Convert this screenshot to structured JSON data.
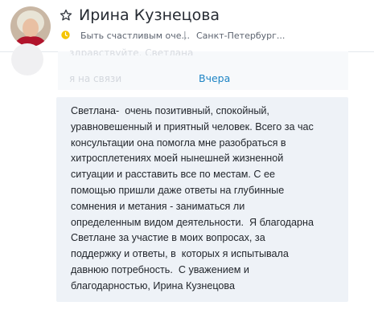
{
  "contact": {
    "name": "Ирина Кузнецова",
    "mood": "Быть счастливым оче...",
    "separator": "|",
    "location": "Санкт-Петербург..."
  },
  "previous_message": {
    "line1": "здравствуйте. Светлана",
    "line2": "я на связи"
  },
  "date_divider": "Вчера",
  "message": {
    "text": "Светлана-  очень позитивный, спокойный,\nуравновешенный и приятный человек. Всего за час\nконсультации она помогла мне разобраться в\nхитросплетениях моей нынешней жизненной\nситуации и расставить все по местам. С ее\nпомощью пришли даже ответы на глубинные\nсомнения и метания - заниматься ли\nопределенным видом деятельности.  Я благодарна\nСветлане за участие в моих вопросах, за\nподдержку и ответы, в  которых я испытывала\nдавнюю потребность.  С уважением и\nблагодарностью, Ирина Кузнецова"
  },
  "colors": {
    "accent": "#1d84c4",
    "bubble": "#eef2f7",
    "mood_icon": "#f5c400"
  }
}
